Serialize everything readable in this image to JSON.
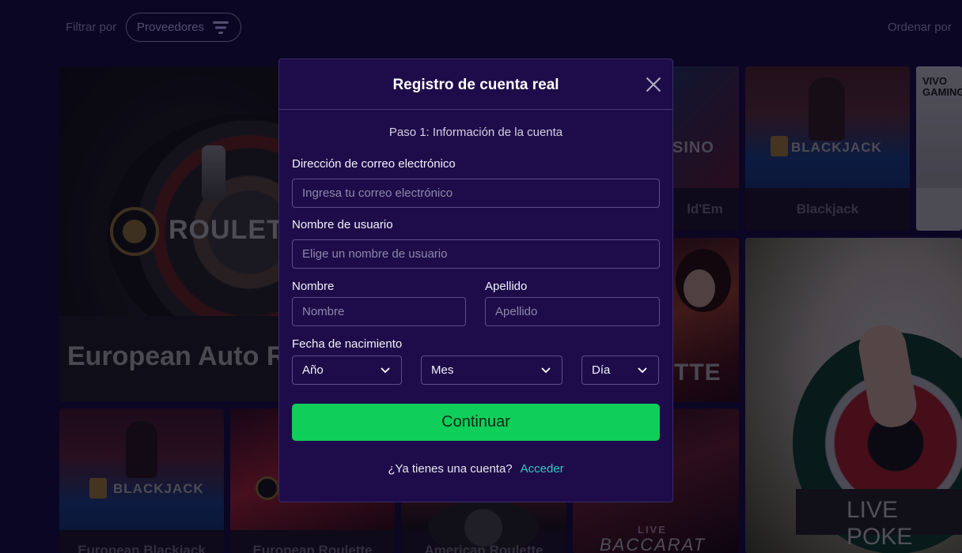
{
  "toolbar": {
    "filter_label": "Filtrar por",
    "providers_label": "Proveedores",
    "sort_label": "Ordenar por"
  },
  "games": {
    "roulette_banner_text": "ROULETT",
    "featured_title": "European Auto R",
    "holdem_partial": "ld'Em",
    "blackjack": "Blackjack",
    "blackjack_logo": "BLACKJACK",
    "casino_partial": "SINO",
    "vivo_logo": "VIVO GAMING",
    "roulette_partial": "TTE",
    "live_poker": "LIVE POKE",
    "european_blackjack": "European Blackjack",
    "european_roulette": "European Roulette",
    "american_roulette": "American Roulette",
    "live_baccarat_top": "LIVE",
    "live_baccarat": "BACCARAT"
  },
  "modal": {
    "title": "Registro de cuenta real",
    "step": "Paso 1: Información de la cuenta",
    "email_label": "Dirección de correo electrónico",
    "email_placeholder": "Ingresa tu correo electrónico",
    "username_label": "Nombre de usuario",
    "username_placeholder": "Elige un nombre de usuario",
    "firstname_label": "Nombre",
    "firstname_placeholder": "Nombre",
    "lastname_label": "Apellido",
    "lastname_placeholder": "Apellido",
    "dob_label": "Fecha de nacimiento",
    "year": "Año",
    "month": "Mes",
    "day": "Día",
    "continue": "Continuar",
    "have_account": "¿Ya tienes una cuenta?",
    "login": "Acceder"
  },
  "colors": {
    "background": "#0d0728",
    "modal": "#1e0c4a",
    "primary_button": "#0fce5a",
    "link": "#33c9c0"
  }
}
